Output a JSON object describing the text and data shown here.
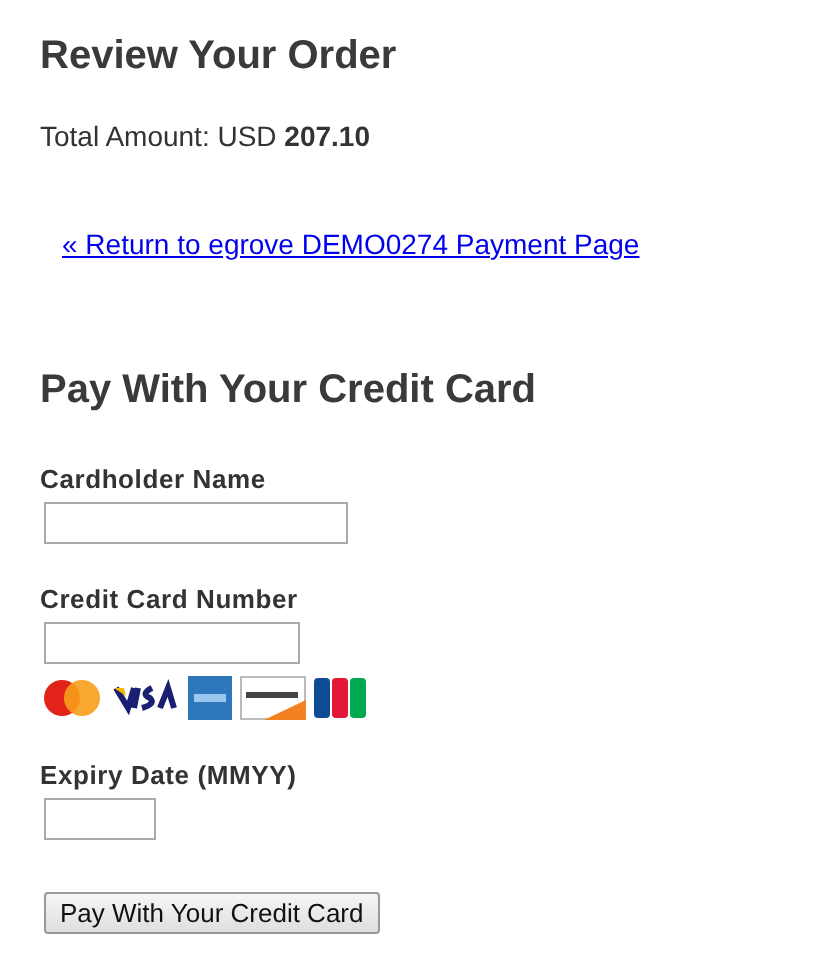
{
  "review": {
    "title": "Review Your Order",
    "total": "Total Amount: USD **207.10**",
    "return_link": "« Return to egrove DEMO0274 Payment Page"
  },
  "payment": {
    "title": "Pay With Your Credit Card",
    "fields": [
      {
        "label": "Cardholder Name"
      },
      {
        "label": "Credit Card Number"
      },
      {
        "label": "Expiry Date (MMYY)"
      }
    ],
    "submit": "Pay With Your Credit Card"
  }
}
